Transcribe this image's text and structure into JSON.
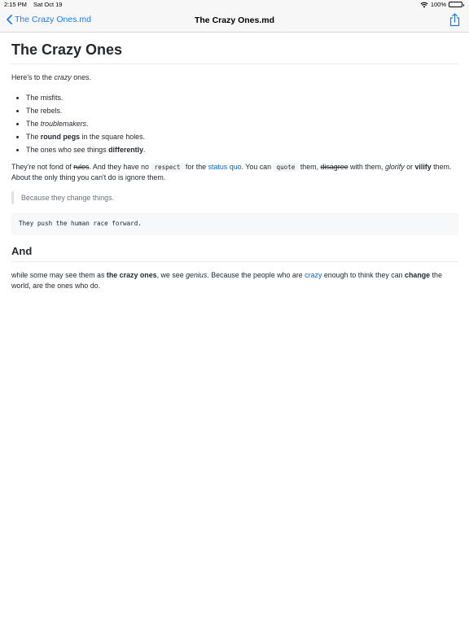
{
  "status_bar": {
    "time": "2:15 PM",
    "date": "Sat Oct 19",
    "battery": "100%"
  },
  "nav": {
    "back_label": "The Crazy Ones.md",
    "title": "The Crazy Ones.md"
  },
  "doc": {
    "h1": "The Crazy Ones",
    "intro": {
      "a": "Here's to the ",
      "em": "crazy",
      "b": " ones."
    },
    "list": {
      "item1": "The misfits.",
      "item2": "The rebels.",
      "item3": {
        "a": "The ",
        "em": "troublemakers",
        "b": "."
      },
      "item4": {
        "a": "The ",
        "strong": "round pegs",
        "b": " in the square holes."
      },
      "item5": {
        "a": "The ones who see things ",
        "strong": "differently",
        "b": "."
      }
    },
    "para2": {
      "t1": "They're not fond of ",
      "del1": "rules",
      "t2": ". And they have no ",
      "code1": "respect",
      "t3": " for the ",
      "link1": "status quo",
      "t4": ". You can ",
      "code2": "quote",
      "t5": " them, ",
      "del2": "disagree",
      "t6": " with them, ",
      "em1": "glorify",
      "t7": " or ",
      "strong1": "vilify",
      "t8": " them. About the only thing you can't do is ignore them."
    },
    "quote": "Because they change things.",
    "code_block": "They push the human race forward.",
    "h2": "And",
    "para3": {
      "t1": "while some may see them as ",
      "strong1": "the crazy ones",
      "t2": ", we see ",
      "em1": "genius",
      "t3": ". Because the people who are ",
      "link1": "crazy",
      "t4": " enough to think they can ",
      "strong2": "change",
      "t5": " the world, are the ones who do."
    }
  },
  "colors": {
    "accent": "#1a7cf4",
    "link": "#0366d6",
    "text": "#24292e",
    "muted": "#6a737d"
  },
  "icons": {
    "back": "chevron-left-icon",
    "share": "share-icon",
    "wifi": "wifi-icon",
    "battery": "battery-icon"
  }
}
